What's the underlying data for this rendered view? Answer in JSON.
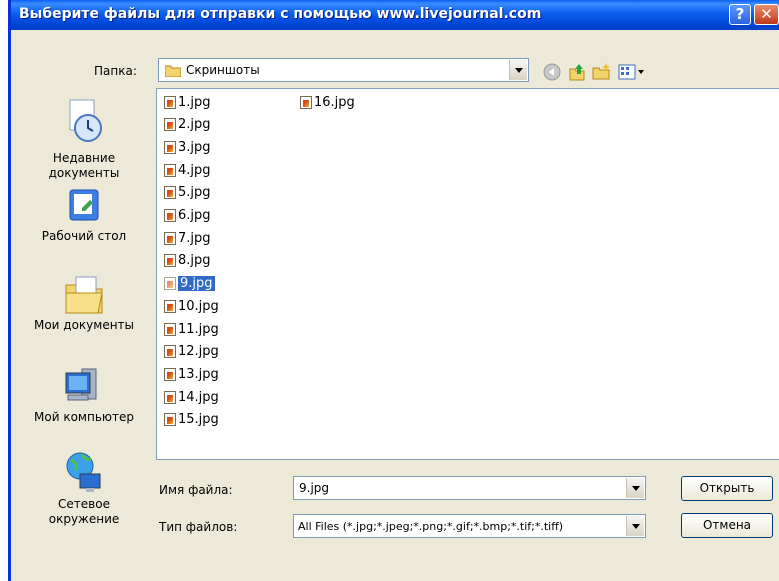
{
  "window": {
    "title": "Выберите файлы для отправки с помощью www.livejournal.com",
    "help_glyph": "?",
    "close_glyph": "✕"
  },
  "toolbar": {
    "folder_label": "Папка:",
    "folder_value": "Скриншоты",
    "back_icon": "back-arrow-icon",
    "up_icon": "up-folder-icon",
    "new_folder_icon": "new-folder-icon",
    "view_menu_icon": "view-menu-icon"
  },
  "places": [
    {
      "label": "Недавние документы",
      "icon": "recent-documents-icon"
    },
    {
      "label": "Рабочий стол",
      "icon": "desktop-icon"
    },
    {
      "label": "Мои документы",
      "icon": "my-documents-icon"
    },
    {
      "label": "Мой компьютер",
      "icon": "my-computer-icon"
    },
    {
      "label": "Сетевое окружение",
      "icon": "network-icon"
    }
  ],
  "files": {
    "column1": [
      "1.jpg",
      "2.jpg",
      "3.jpg",
      "4.jpg",
      "5.jpg",
      "6.jpg",
      "7.jpg",
      "8.jpg",
      "9.jpg",
      "10.jpg",
      "11.jpg",
      "12.jpg",
      "13.jpg",
      "14.jpg",
      "15.jpg"
    ],
    "column2": [
      "16.jpg"
    ],
    "selected": "9.jpg"
  },
  "form": {
    "filename_label": "Имя файла:",
    "filename_value": "9.jpg",
    "filetype_label": "Тип файлов:",
    "filetype_value": "All Files (*.jpg;*.jpeg;*.png;*.gif;*.bmp;*.tif;*.tiff)",
    "open_button": "Открыть",
    "cancel_button": "Отмена"
  },
  "colors": {
    "titlebar": "#0b5ef0",
    "selection": "#316ac5",
    "dialog_bg": "#ece9d8"
  }
}
